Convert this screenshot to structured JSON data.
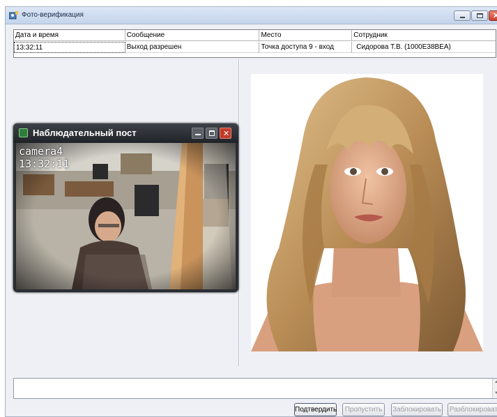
{
  "window": {
    "title": "Фото-верификация",
    "icon": "camera-user-icon"
  },
  "grid": {
    "columns": [
      "Дата и время",
      "Сообщение",
      "Место",
      "Сотрудник"
    ],
    "row": {
      "time": "13:32:11",
      "message": "Выход разрешен",
      "place": "Точка доступа 9 - вход",
      "employee": "Сидорова Т.В. (1000E38BEA)"
    }
  },
  "camera_window": {
    "title": "Наблюдательный пост",
    "camera_name": "camera4",
    "timestamp": "13:32:11"
  },
  "comment": {
    "value": ""
  },
  "actions": {
    "confirm": "Подтвердить",
    "skip": "Пропустить",
    "block": "Заблокировать",
    "unblock": "Разблокировать"
  },
  "colors": {
    "window_bg": "#eef0f5",
    "titlebar": "#c4d4ec",
    "close_red": "#c9412d",
    "camera_frame": "#2a2d32"
  }
}
